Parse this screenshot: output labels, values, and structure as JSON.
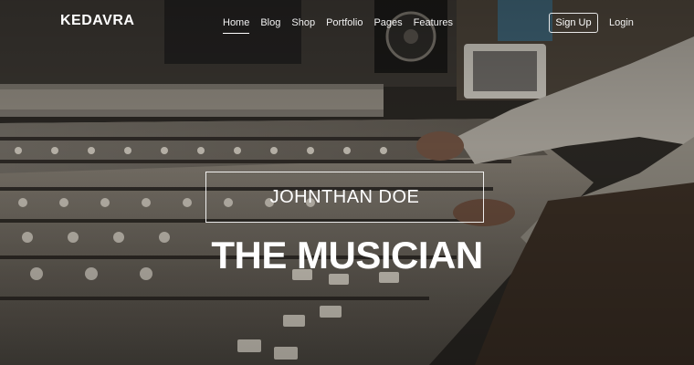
{
  "nav": {
    "brand": "KEDAVRA",
    "menu": [
      {
        "label": "Home",
        "active": true
      },
      {
        "label": "Blog",
        "active": false
      },
      {
        "label": "Shop",
        "active": false
      },
      {
        "label": "Portfolio",
        "active": false
      },
      {
        "label": "Pages",
        "active": false
      },
      {
        "label": "Features",
        "active": false
      }
    ],
    "signup_label": "Sign Up",
    "login_label": "Login"
  },
  "hero": {
    "name": "JOHNTHAN DOE",
    "title": "THE MUSICIAN",
    "background_image": "music studio mixing console with musician's hands"
  }
}
